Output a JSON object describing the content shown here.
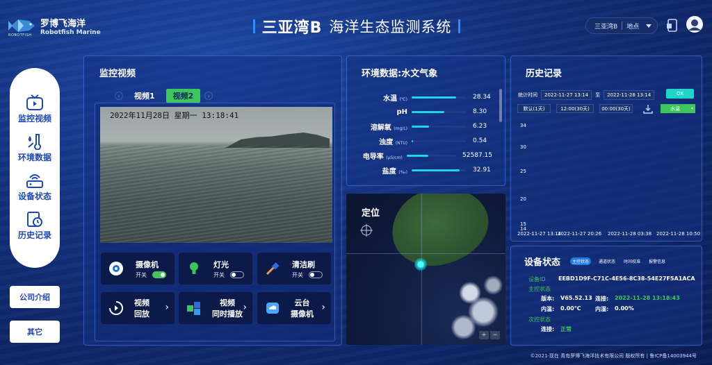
{
  "header": {
    "brand_cn": "罗博飞海洋",
    "brand_en": "Robotfish Marine",
    "brand_tag": "ROBOTFISH",
    "title_bold": "三亚湾B",
    "title_text": "海洋生态监测系统",
    "location_select": {
      "value": "三亚湾B",
      "label": "地点"
    }
  },
  "nav": {
    "items": [
      {
        "label": "监控视频",
        "icon": "tv-icon"
      },
      {
        "label": "环境数据",
        "icon": "thermometer-drop-icon"
      },
      {
        "label": "设备状态",
        "icon": "router-icon"
      },
      {
        "label": "历史记录",
        "icon": "clock-doc-icon"
      }
    ],
    "company": "公司介绍",
    "other": "其它"
  },
  "video": {
    "title": "监控视频",
    "tabs": [
      "视频1",
      "视频2"
    ],
    "active_tab": 1,
    "timestamp": "2022年11月28日  星期一  13:18:41",
    "controls": [
      {
        "label": "摄像机",
        "state": "开关",
        "on": true
      },
      {
        "label": "灯光",
        "state": "开关",
        "on": false
      },
      {
        "label": "清洁刷",
        "state": "开关",
        "on": false
      }
    ],
    "actions": [
      {
        "line1": "视频",
        "line2": "回放"
      },
      {
        "line1": "视频",
        "line2": "同时播放"
      },
      {
        "line1": "云台",
        "line2": "摄像机"
      }
    ]
  },
  "env": {
    "title": "环境数据:水文气象",
    "rows": [
      {
        "name": "水温",
        "unit": "(℃)",
        "value": "28.34",
        "level": 0.82
      },
      {
        "name": "pH",
        "unit": "",
        "value": "8.30",
        "level": 0.6
      },
      {
        "name": "溶解氧",
        "unit": "(mg/L)",
        "value": "6.23",
        "level": 0.32
      },
      {
        "name": "浊度",
        "unit": "(NTU)",
        "value": "0.54",
        "level": 0.03
      },
      {
        "name": "电导率",
        "unit": "(μS/cm)",
        "value": "52587.15",
        "level": 0.45
      },
      {
        "name": "盐度",
        "unit": "(‰)",
        "value": "32.91",
        "level": 0.88
      }
    ]
  },
  "map": {
    "title": "定位"
  },
  "history": {
    "title": "历史记录",
    "time_label": "统计时间",
    "start": "2022-11-27 13:14",
    "to": "至",
    "end": "2022-11-28 13:14",
    "ok": "OK",
    "presets": [
      "默认(1天)",
      "12:00(30天)",
      "00:00(30天)"
    ],
    "metric": "水温",
    "chart_data": {
      "type": "line",
      "yticks": [
        "34",
        "30",
        "25",
        "20",
        "15",
        "14"
      ],
      "xticks": [
        "2022-11-27 13:14",
        "2022-11-27 20:26",
        "2022-11-28 03:38",
        "2022-11-28 10:50"
      ]
    }
  },
  "device": {
    "title": "设备状态",
    "tabs": [
      "主控状态",
      "通道状态",
      "时间校准",
      "报警信息"
    ],
    "id_label": "设备ID",
    "id": "EEBD1D9F-C71C-4E56-8C38-54E27F5A1ACA",
    "main_label": "主控状态",
    "version_label": "版本:",
    "version": "V65.52.13",
    "conn_label": "连接:",
    "conn_time": "2022-11-28 13:18:43",
    "temp_label": "内温:",
    "temp": "0.00℃",
    "hum_label": "内湿:",
    "hum": "0.00%",
    "sub_label": "次控状态",
    "sub_conn_label": "连接:",
    "sub_conn": "正常"
  },
  "footer": "©2021-现在 青岛罗博飞海洋技术有限公司 版权所有 | 鲁ICP备14003944号",
  "colors": {
    "accent": "#3fc65a",
    "cyan": "#20d4e8",
    "navy": "#1d46b8"
  }
}
